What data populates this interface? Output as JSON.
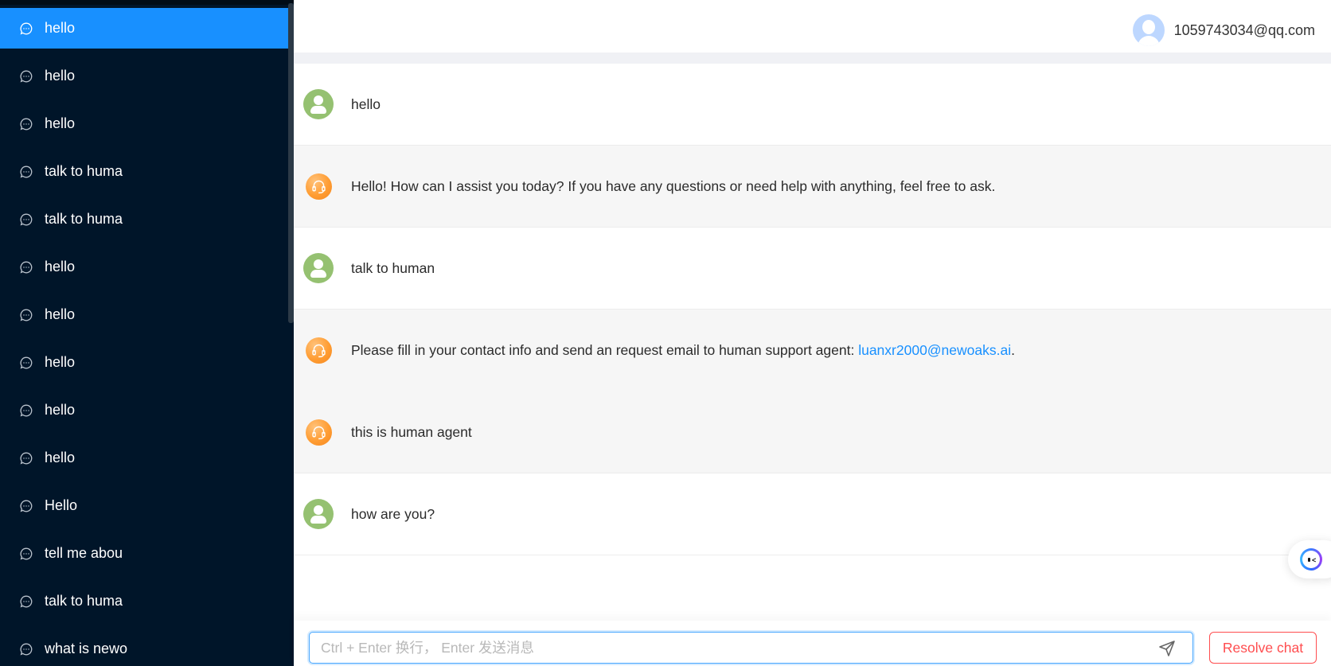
{
  "sidebar": {
    "items": [
      {
        "label": "hello",
        "active": true
      },
      {
        "label": "hello"
      },
      {
        "label": "hello"
      },
      {
        "label": "talk to huma"
      },
      {
        "label": "talk to huma"
      },
      {
        "label": "hello"
      },
      {
        "label": "hello"
      },
      {
        "label": "hello"
      },
      {
        "label": "hello"
      },
      {
        "label": "hello"
      },
      {
        "label": "Hello"
      },
      {
        "label": "tell me abou"
      },
      {
        "label": "talk to huma"
      },
      {
        "label": "what is newo"
      }
    ],
    "item_icon": "chat-bubble-icon"
  },
  "header": {
    "user_email": "1059743034@qq.com",
    "avatar_icon": "user-avatar-icon"
  },
  "messages": [
    {
      "role": "user",
      "text": "hello"
    },
    {
      "role": "agent",
      "text": "Hello! How can I assist you today? If you have any questions or need help with anything, feel free to ask."
    },
    {
      "role": "user",
      "text": "talk to human"
    },
    {
      "role": "agent",
      "text": "Please fill in your contact info and send an request email to human support agent: ",
      "link": "luanxr2000@newoaks.ai",
      "suffix": "."
    },
    {
      "role": "agent",
      "text": "this is human agent"
    },
    {
      "role": "user",
      "text": "how are you?"
    }
  ],
  "input": {
    "placeholder": "Ctrl + Enter 换行， Enter 发送消息",
    "value": ""
  },
  "actions": {
    "resolve_label": "Resolve chat",
    "send_icon": "send-icon"
  },
  "colors": {
    "sidebar_bg": "#001529",
    "active_item": "#1890ff",
    "link": "#1890ff",
    "resolve": "#ff4d4f",
    "user_avatar": "#95c171",
    "agent_avatar": "#ff9d33"
  }
}
